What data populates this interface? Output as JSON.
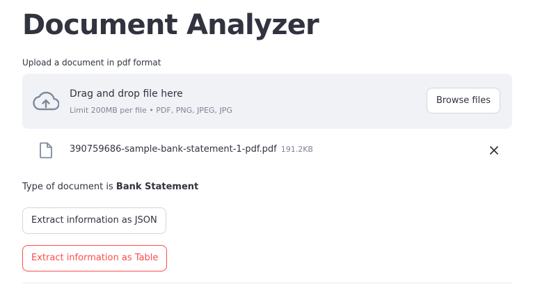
{
  "app": {
    "title": "Document Analyzer"
  },
  "uploader": {
    "label": "Upload a document in pdf format",
    "drop_title": "Drag and drop file here",
    "limit_text": "Limit 200MB per file • PDF, PNG, JPEG, JPG",
    "browse_label": "Browse files",
    "icon": "cloud-upload-icon"
  },
  "file": {
    "name": "390759686-sample-bank-statement-1-pdf.pdf",
    "size": "191.2KB",
    "icon": "file-icon",
    "remove_icon": "close-icon"
  },
  "result": {
    "prefix": "Type of document is ",
    "doc_type": "Bank Statement"
  },
  "actions": {
    "json_label": "Extract information as JSON",
    "table_label": "Extract information as Table"
  },
  "colors": {
    "primary": "#ff4b4b",
    "text": "#31333f",
    "muted": "#808495",
    "dropzone_bg": "#f0f2f6"
  }
}
